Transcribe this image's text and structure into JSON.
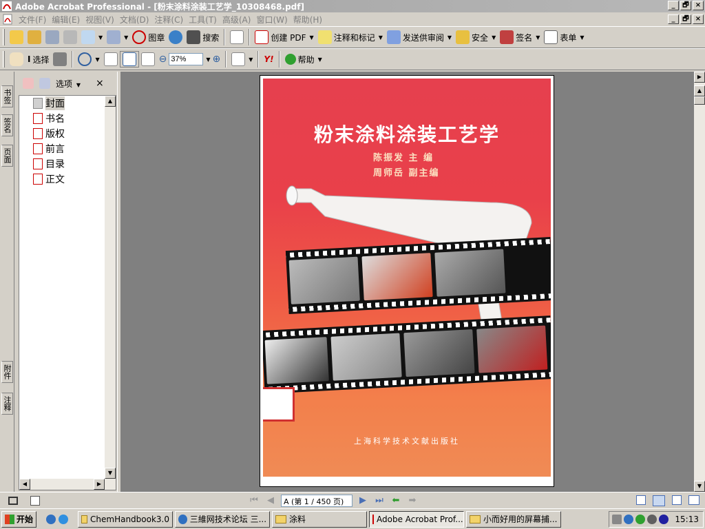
{
  "window": {
    "title": "Adobe Acrobat Professional - [粉末涂料涂装工艺学_10308468.pdf]",
    "min_label": "_",
    "restore_label": "🗗",
    "close_label": "×"
  },
  "menu": [
    "文件(F)",
    "编辑(E)",
    "视图(V)",
    "文档(D)",
    "注释(C)",
    "工具(T)",
    "高级(A)",
    "窗口(W)",
    "帮助(H)"
  ],
  "toolbar1": {
    "stamp_label": "图章",
    "search_label": "搜索",
    "create_pdf_label": "创建 PDF",
    "comment_label": "注释和标记",
    "send_review_label": "发送供审阅",
    "security_label": "安全",
    "sign_label": "签名",
    "forms_label": "表单"
  },
  "toolbar2": {
    "select_label": "选择",
    "zoom_value": "37%",
    "help_label": "帮助"
  },
  "side_tabs": [
    "书签",
    "签名",
    "页面",
    "附件",
    "注释"
  ],
  "nav": {
    "options_label": "选项",
    "items": [
      "封面",
      "书名",
      "版权",
      "前言",
      "目录",
      "正文"
    ]
  },
  "cover": {
    "title": "粉末涂料涂装工艺学",
    "author1": "陈振发   主   编",
    "author2": "周师岳   副主编",
    "publisher": "上海科学技术文献出版社"
  },
  "status": {
    "page_indicator": "A (第 1 / 450 页)"
  },
  "taskbar": {
    "start_label": "开始",
    "tasks": [
      "ChemHandbook3.0",
      "三維网技术论坛 三...",
      "涂料",
      "Adobe Acrobat Prof...",
      "小而好用的屏幕捕..."
    ],
    "clock": "15:13"
  },
  "colors": {
    "cover_top": "#e6404e",
    "cover_bottom": "#f08b55",
    "acrobat_red": "#c00000"
  }
}
